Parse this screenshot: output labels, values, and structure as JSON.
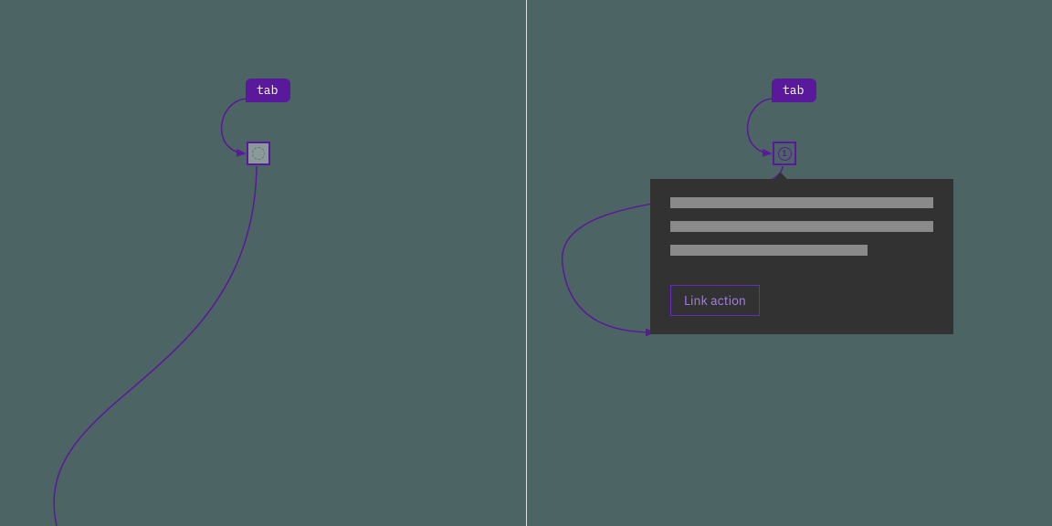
{
  "colors": {
    "background": "#4d6464",
    "accent": "#5a189a",
    "popover_bg": "#323232",
    "popover_line": "#8a8a8a",
    "link_border": "#6929c4",
    "link_text": "#a77ded",
    "divider": "#e0e0e0"
  },
  "left": {
    "tab_label": "tab",
    "marker_state": "inactive"
  },
  "right": {
    "tab_label": "tab",
    "marker_state": "active",
    "marker_number": "1",
    "popover": {
      "link_action_label": "Link action"
    }
  }
}
